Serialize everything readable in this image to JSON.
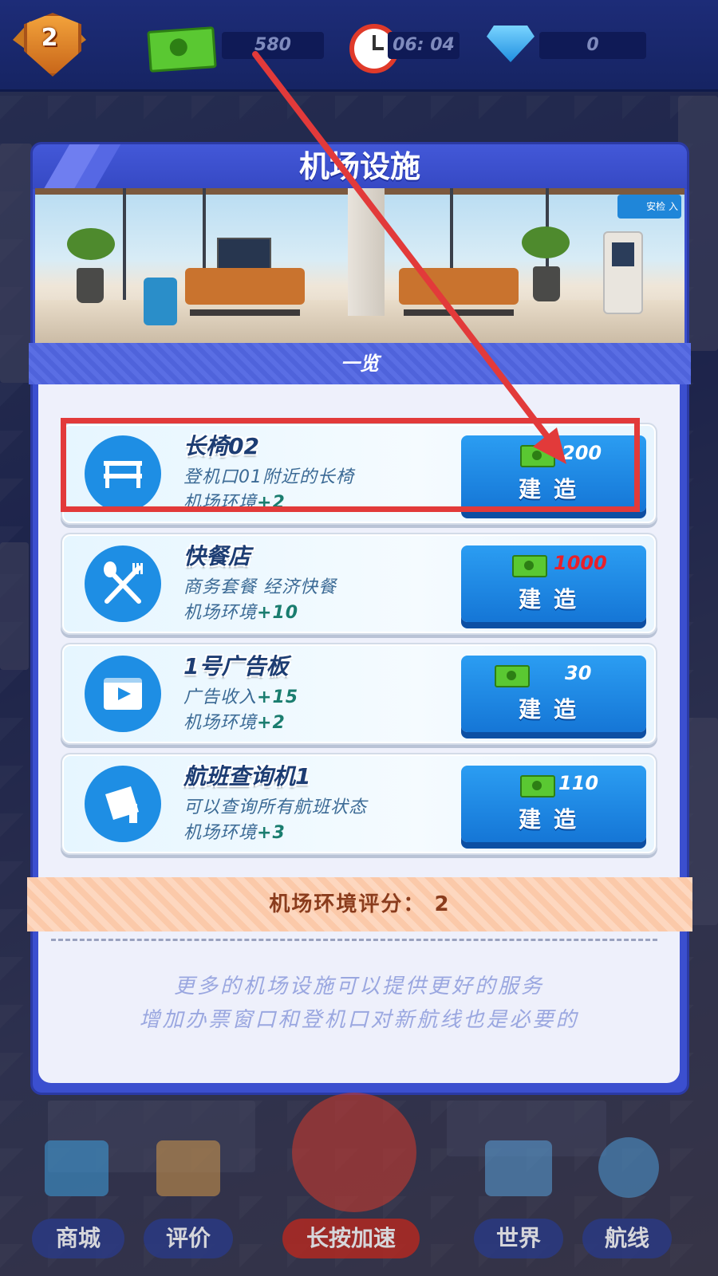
{
  "hud": {
    "level": "2",
    "cash": "580",
    "timer": "06: 04",
    "gems": "0"
  },
  "dialog": {
    "title": "机场设施",
    "banner_sign": "安检 入",
    "section_label": "一览"
  },
  "items": [
    {
      "name": "长椅02",
      "desc": "登机口01附近的长椅",
      "env_label": "机场环境",
      "env_value": "+2",
      "cost": "200",
      "cost_red": false,
      "button": "建造",
      "icon": "bench-icon"
    },
    {
      "name": "快餐店",
      "desc": "商务套餐 经济快餐",
      "env_label": "机场环境",
      "env_value": "+10",
      "cost": "1000",
      "cost_red": true,
      "button": "建造",
      "icon": "fork-spoon-icon"
    },
    {
      "name": "1号广告板",
      "desc": "广告收入",
      "desc_value": "+15",
      "env_label": "机场环境",
      "env_value": "+2",
      "cost": "30",
      "cost_red": false,
      "button": "建造",
      "icon": "video-board-icon"
    },
    {
      "name": "航班查询机1",
      "desc": "可以查询所有航班状态",
      "env_label": "机场环境",
      "env_value": "+3",
      "cost": "110",
      "cost_red": false,
      "button": "建造",
      "icon": "kiosk-icon"
    }
  ],
  "score": {
    "label": "机场环境评分：",
    "value": "2"
  },
  "tips": {
    "line1": "更多的机场设施可以提供更好的服务",
    "line2": "增加办票窗口和登机口对新航线也是必要的"
  },
  "nav": {
    "shop": "商城",
    "review": "评价",
    "speed": "长按加速",
    "world": "世界",
    "routes": "航线"
  },
  "colors": {
    "dialog": "#3b4fcf",
    "button": "#1e8ee4",
    "highlight": "#e23a3a",
    "cost_insufficient": "#e8202a"
  }
}
